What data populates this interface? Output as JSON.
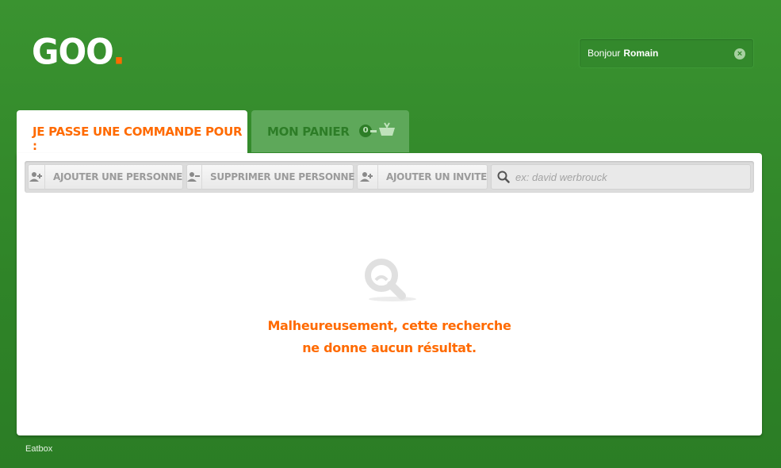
{
  "brand": {
    "logo_text": "GOO",
    "logo_dot": ".",
    "accent": "#ff6a00"
  },
  "user": {
    "greeting": "Bonjour",
    "name": "Romain",
    "close_icon": "close-circle-icon"
  },
  "tabs": {
    "active_label": "JE PASSE UNE COMMANDE POUR :",
    "cart_label": "MON PANIER",
    "cart_count": "0"
  },
  "toolbar": {
    "add_person": "AJOUTER UNE PERSONNE",
    "remove_person": "SUPPRIMER UNE PERSONNE",
    "add_guest": "AJOUTER UN INVITE",
    "search_placeholder": "ex: david werbrouck"
  },
  "empty_state": {
    "line1": "Malheureusement, cette recherche",
    "line2": "ne donne aucun résultat."
  },
  "footer": {
    "text": "Eatbox"
  }
}
